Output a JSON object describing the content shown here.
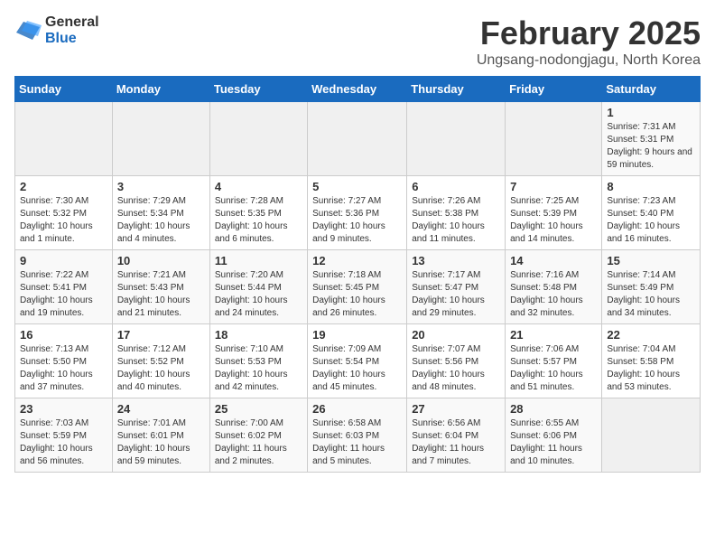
{
  "logo": {
    "general": "General",
    "blue": "Blue"
  },
  "title": "February 2025",
  "subtitle": "Ungsang-nodongjagu, North Korea",
  "headers": [
    "Sunday",
    "Monday",
    "Tuesday",
    "Wednesday",
    "Thursday",
    "Friday",
    "Saturday"
  ],
  "weeks": [
    [
      {
        "day": "",
        "info": ""
      },
      {
        "day": "",
        "info": ""
      },
      {
        "day": "",
        "info": ""
      },
      {
        "day": "",
        "info": ""
      },
      {
        "day": "",
        "info": ""
      },
      {
        "day": "",
        "info": ""
      },
      {
        "day": "1",
        "info": "Sunrise: 7:31 AM\nSunset: 5:31 PM\nDaylight: 9 hours and 59 minutes."
      }
    ],
    [
      {
        "day": "2",
        "info": "Sunrise: 7:30 AM\nSunset: 5:32 PM\nDaylight: 10 hours and 1 minute."
      },
      {
        "day": "3",
        "info": "Sunrise: 7:29 AM\nSunset: 5:34 PM\nDaylight: 10 hours and 4 minutes."
      },
      {
        "day": "4",
        "info": "Sunrise: 7:28 AM\nSunset: 5:35 PM\nDaylight: 10 hours and 6 minutes."
      },
      {
        "day": "5",
        "info": "Sunrise: 7:27 AM\nSunset: 5:36 PM\nDaylight: 10 hours and 9 minutes."
      },
      {
        "day": "6",
        "info": "Sunrise: 7:26 AM\nSunset: 5:38 PM\nDaylight: 10 hours and 11 minutes."
      },
      {
        "day": "7",
        "info": "Sunrise: 7:25 AM\nSunset: 5:39 PM\nDaylight: 10 hours and 14 minutes."
      },
      {
        "day": "8",
        "info": "Sunrise: 7:23 AM\nSunset: 5:40 PM\nDaylight: 10 hours and 16 minutes."
      }
    ],
    [
      {
        "day": "9",
        "info": "Sunrise: 7:22 AM\nSunset: 5:41 PM\nDaylight: 10 hours and 19 minutes."
      },
      {
        "day": "10",
        "info": "Sunrise: 7:21 AM\nSunset: 5:43 PM\nDaylight: 10 hours and 21 minutes."
      },
      {
        "day": "11",
        "info": "Sunrise: 7:20 AM\nSunset: 5:44 PM\nDaylight: 10 hours and 24 minutes."
      },
      {
        "day": "12",
        "info": "Sunrise: 7:18 AM\nSunset: 5:45 PM\nDaylight: 10 hours and 26 minutes."
      },
      {
        "day": "13",
        "info": "Sunrise: 7:17 AM\nSunset: 5:47 PM\nDaylight: 10 hours and 29 minutes."
      },
      {
        "day": "14",
        "info": "Sunrise: 7:16 AM\nSunset: 5:48 PM\nDaylight: 10 hours and 32 minutes."
      },
      {
        "day": "15",
        "info": "Sunrise: 7:14 AM\nSunset: 5:49 PM\nDaylight: 10 hours and 34 minutes."
      }
    ],
    [
      {
        "day": "16",
        "info": "Sunrise: 7:13 AM\nSunset: 5:50 PM\nDaylight: 10 hours and 37 minutes."
      },
      {
        "day": "17",
        "info": "Sunrise: 7:12 AM\nSunset: 5:52 PM\nDaylight: 10 hours and 40 minutes."
      },
      {
        "day": "18",
        "info": "Sunrise: 7:10 AM\nSunset: 5:53 PM\nDaylight: 10 hours and 42 minutes."
      },
      {
        "day": "19",
        "info": "Sunrise: 7:09 AM\nSunset: 5:54 PM\nDaylight: 10 hours and 45 minutes."
      },
      {
        "day": "20",
        "info": "Sunrise: 7:07 AM\nSunset: 5:56 PM\nDaylight: 10 hours and 48 minutes."
      },
      {
        "day": "21",
        "info": "Sunrise: 7:06 AM\nSunset: 5:57 PM\nDaylight: 10 hours and 51 minutes."
      },
      {
        "day": "22",
        "info": "Sunrise: 7:04 AM\nSunset: 5:58 PM\nDaylight: 10 hours and 53 minutes."
      }
    ],
    [
      {
        "day": "23",
        "info": "Sunrise: 7:03 AM\nSunset: 5:59 PM\nDaylight: 10 hours and 56 minutes."
      },
      {
        "day": "24",
        "info": "Sunrise: 7:01 AM\nSunset: 6:01 PM\nDaylight: 10 hours and 59 minutes."
      },
      {
        "day": "25",
        "info": "Sunrise: 7:00 AM\nSunset: 6:02 PM\nDaylight: 11 hours and 2 minutes."
      },
      {
        "day": "26",
        "info": "Sunrise: 6:58 AM\nSunset: 6:03 PM\nDaylight: 11 hours and 5 minutes."
      },
      {
        "day": "27",
        "info": "Sunrise: 6:56 AM\nSunset: 6:04 PM\nDaylight: 11 hours and 7 minutes."
      },
      {
        "day": "28",
        "info": "Sunrise: 6:55 AM\nSunset: 6:06 PM\nDaylight: 11 hours and 10 minutes."
      },
      {
        "day": "",
        "info": ""
      }
    ]
  ]
}
